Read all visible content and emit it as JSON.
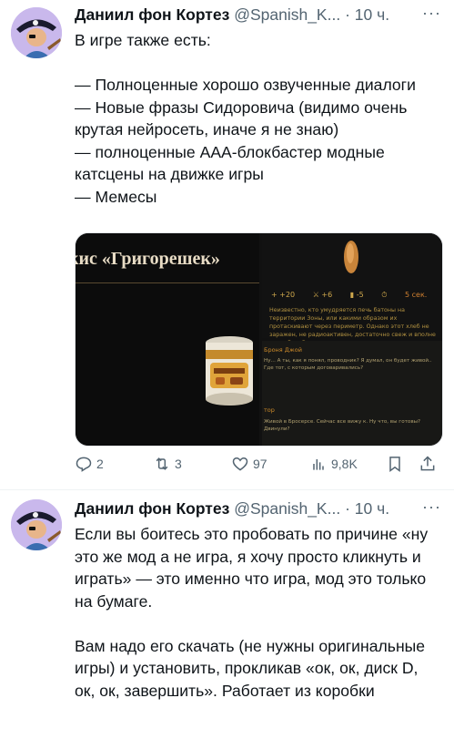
{
  "tweets": [
    {
      "author": "Даниил фон Кортез",
      "handle": "@Spanish_K...",
      "dot": "·",
      "time": "10 ч.",
      "more": "···",
      "text": "В игре также есть:\n\n— Полноценные хорошо озвученные диалоги\n— Новые фразы Сидоровича (видимо очень крутая нейросеть, иначе я не знаю)\n— полноценные ААА-блокбастер модные катсцены на движке игры\n— Мемесы",
      "media": {
        "game_title": "кис «Григорешек»",
        "stats": [
          "+ +20",
          "⚔ +6",
          "▮ -5",
          "⏱",
          "5 сек."
        ],
        "description": "Неизвестно, кто умудряется печь батоны на территории Зоны, или какими образом их протаскивают через периметр. Однако этот хлеб не заражен, не радиоактивен, достаточно свеж и вполне съедобен. Во",
        "speaker_1": "Броня Джой",
        "line_1": "Ну... А ты, как я понял, проводник? Я думал, он будет живой.. Где тот, с которым договаривались?",
        "speaker_2": "тор",
        "line_2": "Живой в Бросерсе. Сейчас все вижу к. Ну что, вы готовы? Двинули?"
      },
      "actions": {
        "reply": "2",
        "retweet": "3",
        "like": "97",
        "views": "9,8K"
      }
    },
    {
      "author": "Даниил фон Кортез",
      "handle": "@Spanish_K...",
      "dot": "·",
      "time": "10 ч.",
      "more": "···",
      "text": "Если вы боитесь это пробовать по причине «ну это же мод а не игра, я хочу просто кликнуть и играть» — это именно что игра, мод это только на бумаге.\n\nВам надо его скачать (не нужны оригинальные игры) и установить, прокликав «ок, ок, диск D, ок, ок, завершить». Работает из коробки"
    }
  ],
  "colors": {
    "text": "#0f1419",
    "muted": "#536471",
    "avatar_bg": "#c9b8ec"
  }
}
